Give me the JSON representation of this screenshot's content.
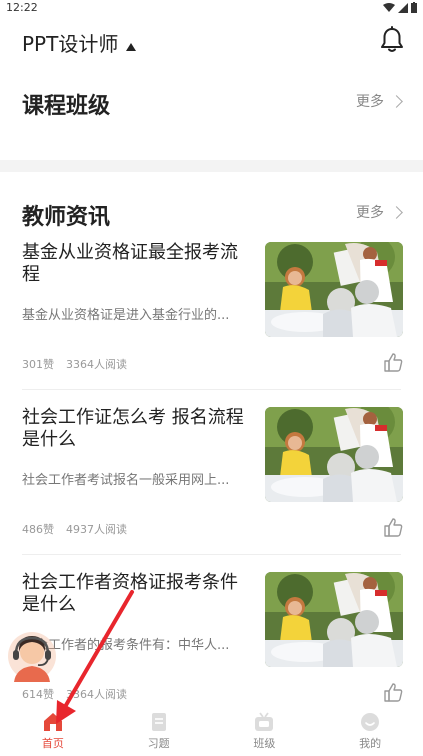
{
  "status_bar": {
    "time": "12:22"
  },
  "header": {
    "title": "PPT设计师",
    "icons": [
      "caret-down-icon",
      "bell-icon"
    ]
  },
  "course_section": {
    "title": "课程班级",
    "more_label": "更多"
  },
  "teacher_section": {
    "title": "教师资讯",
    "more_label": "更多"
  },
  "articles": [
    {
      "title": "基金从业资格证最全报考流程",
      "desc": "基金从业资格证是进入基金行业的...",
      "likes": "301赞",
      "reads": "3364人阅读"
    },
    {
      "title": "社会工作证怎么考 报名流程是什么",
      "desc": "社会工作者考试报名一般采用网上...",
      "likes": "486赞",
      "reads": "4937人阅读"
    },
    {
      "title": "社会工作者资格证报考条件是什么",
      "desc": "社会工作者的报考条件有：中华人...",
      "likes": "614赞",
      "reads": "3364人阅读"
    }
  ],
  "tabbar": {
    "tabs": [
      {
        "label": "首页",
        "icon": "home-icon",
        "active": true
      },
      {
        "label": "习题",
        "icon": "exercise-icon",
        "active": false
      },
      {
        "label": "班级",
        "icon": "class-icon",
        "active": false
      },
      {
        "label": "我的",
        "icon": "profile-icon",
        "active": false
      }
    ]
  },
  "colors": {
    "accent": "#e5483a",
    "text": "#222222",
    "muted": "#888888",
    "band": "#f3f3f3"
  }
}
